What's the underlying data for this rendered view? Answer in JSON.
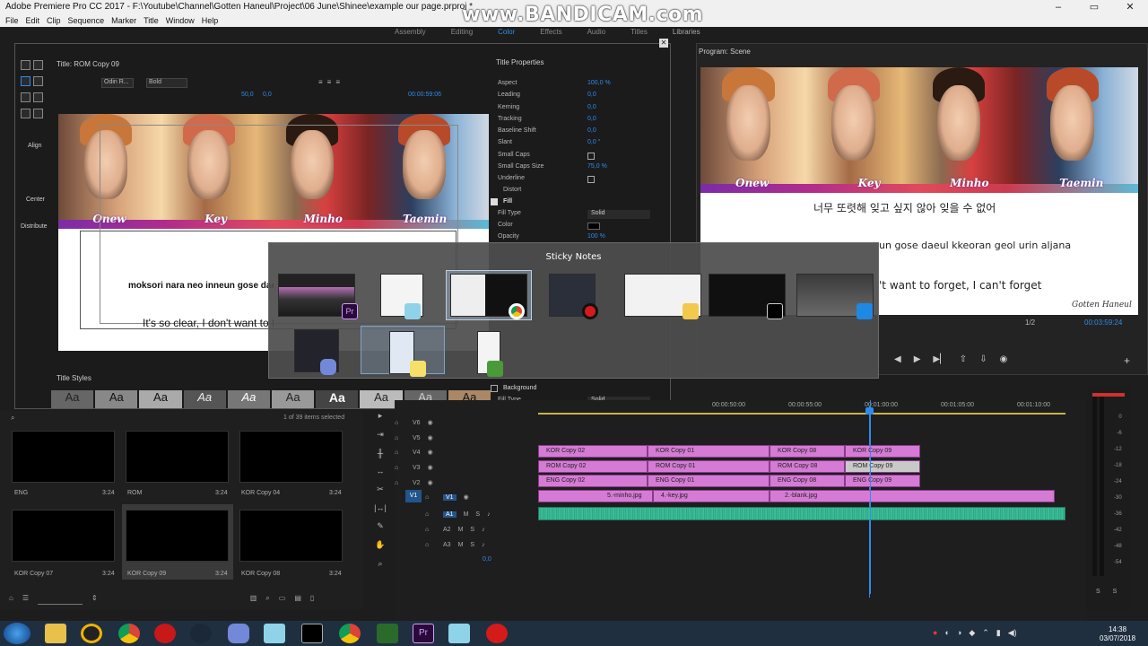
{
  "window": {
    "title": "Adobe Premiere Pro CC 2017 - F:\\Youtube\\Channel\\Gotten Haneul\\Project\\06 June\\Shinee\\example our page.prproj *"
  },
  "watermark": "www.BANDICAM.com",
  "menu": [
    "File",
    "Edit",
    "Clip",
    "Sequence",
    "Marker",
    "Title",
    "Window",
    "Help"
  ],
  "workspaces": {
    "items": [
      "Assembly",
      "Editing",
      "Color",
      "Effects",
      "Audio",
      "Titles",
      "Libraries"
    ],
    "active": "Color"
  },
  "titler": {
    "panel_title": "Title: ROM Copy 09",
    "font_family": "Odin R...",
    "font_style": "Bold",
    "font_size": "50,0",
    "kerning": "0,0",
    "timecode": "00:00:59:06",
    "align_label": "Align",
    "center_label": "Center",
    "distribute_label": "Distribute",
    "styles_label": "Title Styles",
    "style_sample": "Aa",
    "canvas": {
      "line1": "moksori nara neo inneun gose daeul kkeoran geol urin aljana",
      "line2": "It's so clear, I don't want to forget, I can't forget"
    }
  },
  "members": [
    "Onew",
    "Key",
    "Minho",
    "Taemin"
  ],
  "properties": {
    "title": "Title Properties",
    "rows": [
      {
        "label": "Aspect",
        "value": "100,0 %"
      },
      {
        "label": "Leading",
        "value": "0,0"
      },
      {
        "label": "Kerning",
        "value": "0,0"
      },
      {
        "label": "Tracking",
        "value": "0,0"
      },
      {
        "label": "Baseline Shift",
        "value": "0,0"
      },
      {
        "label": "Slant",
        "value": "0,0 °"
      },
      {
        "label": "Small Caps",
        "value": ""
      },
      {
        "label": "Small Caps Size",
        "value": "75,0 %"
      },
      {
        "label": "Underline",
        "value": ""
      },
      {
        "label": "Distort",
        "value": ""
      },
      {
        "label": "Fill",
        "value": ""
      },
      {
        "label": "Fill Type",
        "value": "Solid"
      },
      {
        "label": "Color",
        "value": ""
      },
      {
        "label": "Opacity",
        "value": "100 %"
      }
    ],
    "background_label": "Background",
    "bg_fill_type": "Fill Type",
    "bg_fill_value": "Solid"
  },
  "program": {
    "title": "Program: Scene",
    "korean_line": "너무 또렷해 잊고 싶지 않아 잊을 수 없어",
    "line1": "un gose daeul kkeoran geol urin aljana",
    "line2": "'t want to forget, I can't forget",
    "signature": "Gotten Haneul",
    "zoom": "1/2",
    "timecode": "00:03:59:24"
  },
  "switcher": {
    "title": "Sticky Notes"
  },
  "project": {
    "items_selected": "1 of 39 items selected",
    "clips": [
      {
        "name": "ENG",
        "duration": "3:24"
      },
      {
        "name": "ROM",
        "duration": "3:24"
      },
      {
        "name": "KOR Copy 04",
        "duration": "3:24"
      },
      {
        "name": "KOR Copy 07",
        "duration": "3:24"
      },
      {
        "name": "KOR Copy 09",
        "duration": "3:24"
      },
      {
        "name": "KOR Copy 08",
        "duration": "3:24"
      }
    ]
  },
  "timeline": {
    "ruler": [
      "00:00:50:00",
      "00:00:55:00",
      "00:01:00:00",
      "00:01:05:00",
      "00:01:10:00"
    ],
    "video_tracks": [
      "V6",
      "V5",
      "V4",
      "V3",
      "V2",
      "V1"
    ],
    "audio_tracks": [
      "A1",
      "A2",
      "A3"
    ],
    "source_v1": "V1",
    "master_value": "0,0",
    "clips_v4": [
      "KOR Copy 02",
      "KOR Copy 01",
      "KOR Copy 08",
      "KOR Copy 09"
    ],
    "clips_v3": [
      "ROM Copy 02",
      "ROM Copy 01",
      "ROM Copy 08",
      "ROM Copy 09"
    ],
    "clips_v2": [
      "ENG Copy 02",
      "ENG Copy 01",
      "ENG Copy 08",
      "ENG Copy 09"
    ],
    "clips_v1": [
      "5.-minho.jpg",
      "4.-key.jpg",
      "2.-blank.jpg"
    ]
  },
  "meters": {
    "labels": [
      "0",
      "-6",
      "-12",
      "-18",
      "-24",
      "-30",
      "-36",
      "-42",
      "-48",
      "-54"
    ],
    "solo": [
      "S",
      "S"
    ]
  },
  "taskbar": {
    "time": "14:38",
    "date": "03/07/2018"
  },
  "colors": {
    "accent": "#2d8ceb",
    "clip": "#d57bd5",
    "audio": "#3dbf9a"
  }
}
